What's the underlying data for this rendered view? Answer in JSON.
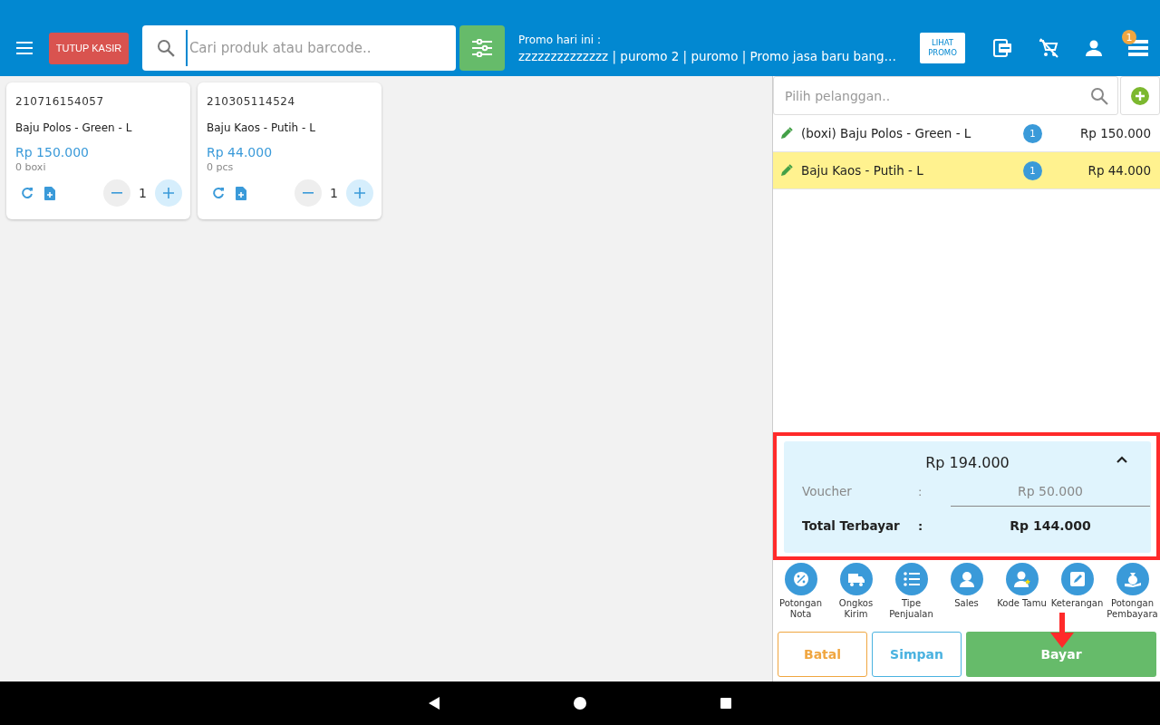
{
  "header": {
    "close_button": "TUTUP KASIR",
    "search": {
      "placeholder": "Cari produk atau barcode.."
    },
    "promo_label": "Promo hari ini :",
    "promo_text": "zzzzzzzzzzzzzz | puromo 2 | puromo | Promo jasa baru bang…",
    "promo_button": "LIHAT PROMO",
    "menu_badge": "1"
  },
  "products": [
    {
      "code": "210716154057",
      "name": "Baju Polos - Green - L",
      "price": "Rp 150.000",
      "stock": "0 boxi",
      "qty": "1"
    },
    {
      "code": "210305114524",
      "name": "Baju Kaos - Putih - L",
      "price": "Rp 44.000",
      "stock": "0 pcs",
      "qty": "1"
    }
  ],
  "customer": {
    "placeholder": "Pilih pelanggan.."
  },
  "cart": [
    {
      "name": "(boxi) Baju Polos - Green - L",
      "qty": "1",
      "price": "Rp 150.000",
      "selected": false
    },
    {
      "name": "Baju Kaos - Putih - L",
      "qty": "1",
      "price": "Rp 44.000",
      "selected": true
    }
  ],
  "summary": {
    "subtotal": "Rp 194.000",
    "expanded": true,
    "highlighted": true,
    "rows": [
      {
        "label": "Voucher",
        "sep": ":",
        "value": "Rp 50.000",
        "kind": "discount"
      },
      {
        "label": "Total Terbayar",
        "sep": ":",
        "value": "Rp 144.000",
        "kind": "total"
      }
    ]
  },
  "actions": [
    {
      "label": "Potongan Nota",
      "kind": "percent"
    },
    {
      "label": "Ongkos Kirim",
      "kind": "truck"
    },
    {
      "label": "Tipe Penjualan",
      "kind": "list"
    },
    {
      "label": "Sales",
      "kind": "person"
    },
    {
      "label": "Kode Tamu",
      "kind": "guest"
    },
    {
      "label": "Keterangan",
      "kind": "note"
    },
    {
      "label": "Potongan Pembayara",
      "kind": "money"
    }
  ],
  "buttons": [
    {
      "label": "Batal",
      "kind": "cancel"
    },
    {
      "label": "Simpan",
      "kind": "save"
    },
    {
      "label": "Bayar",
      "kind": "pay"
    }
  ]
}
